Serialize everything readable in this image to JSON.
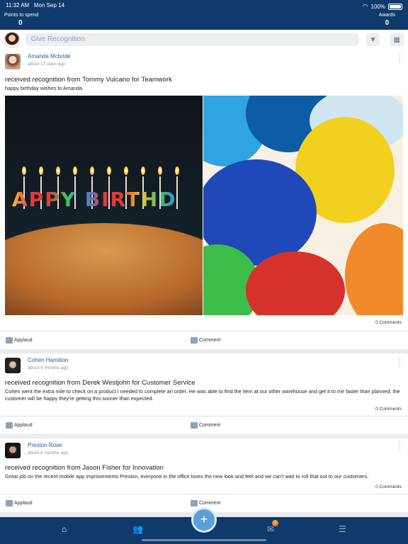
{
  "status": {
    "time": "11:32 AM",
    "date": "Mon Sep 14",
    "battery": "100%"
  },
  "header": {
    "points_label": "Points to spend",
    "points_value": "0",
    "awards_label": "Awards",
    "awards_value": "0"
  },
  "search": {
    "placeholder": "Give Recognition"
  },
  "posts": [
    {
      "name": "Amanda Mcbride",
      "ago": "about 17 days ago",
      "headline": "received recognition from Tommy Vulcano for Teamwork",
      "message": "happy birthday wishes to Amanda",
      "comments": "0 Comments",
      "photo_text": "APPY BIRTHD"
    },
    {
      "name": "Cohen Hamilton",
      "ago": "about 6 months ago",
      "headline": "received recognition from Derek Westjohn for Customer Service",
      "message": "Cohen went the extra mile to check on a product I needed to complete an order. He was able to find the item at our other warehouse and get it to me faster than planned, the customer will be happy they're getting this sooner than expected.",
      "comments": "0 Comments"
    },
    {
      "name": "Preston Rose",
      "ago": "about 6 months ago",
      "headline": "received recognition from Jason Fisher for Innovation",
      "message": "Great job on the recent mobile app improvements Preston, everyone in the office loves the new look and feel and we can't wait to roll that out to our customers.",
      "comments": "0 Comments"
    }
  ],
  "actions": {
    "applaud": "Applaud",
    "comment": "Comment"
  },
  "nav": {
    "badge": "1",
    "fab": "+"
  }
}
